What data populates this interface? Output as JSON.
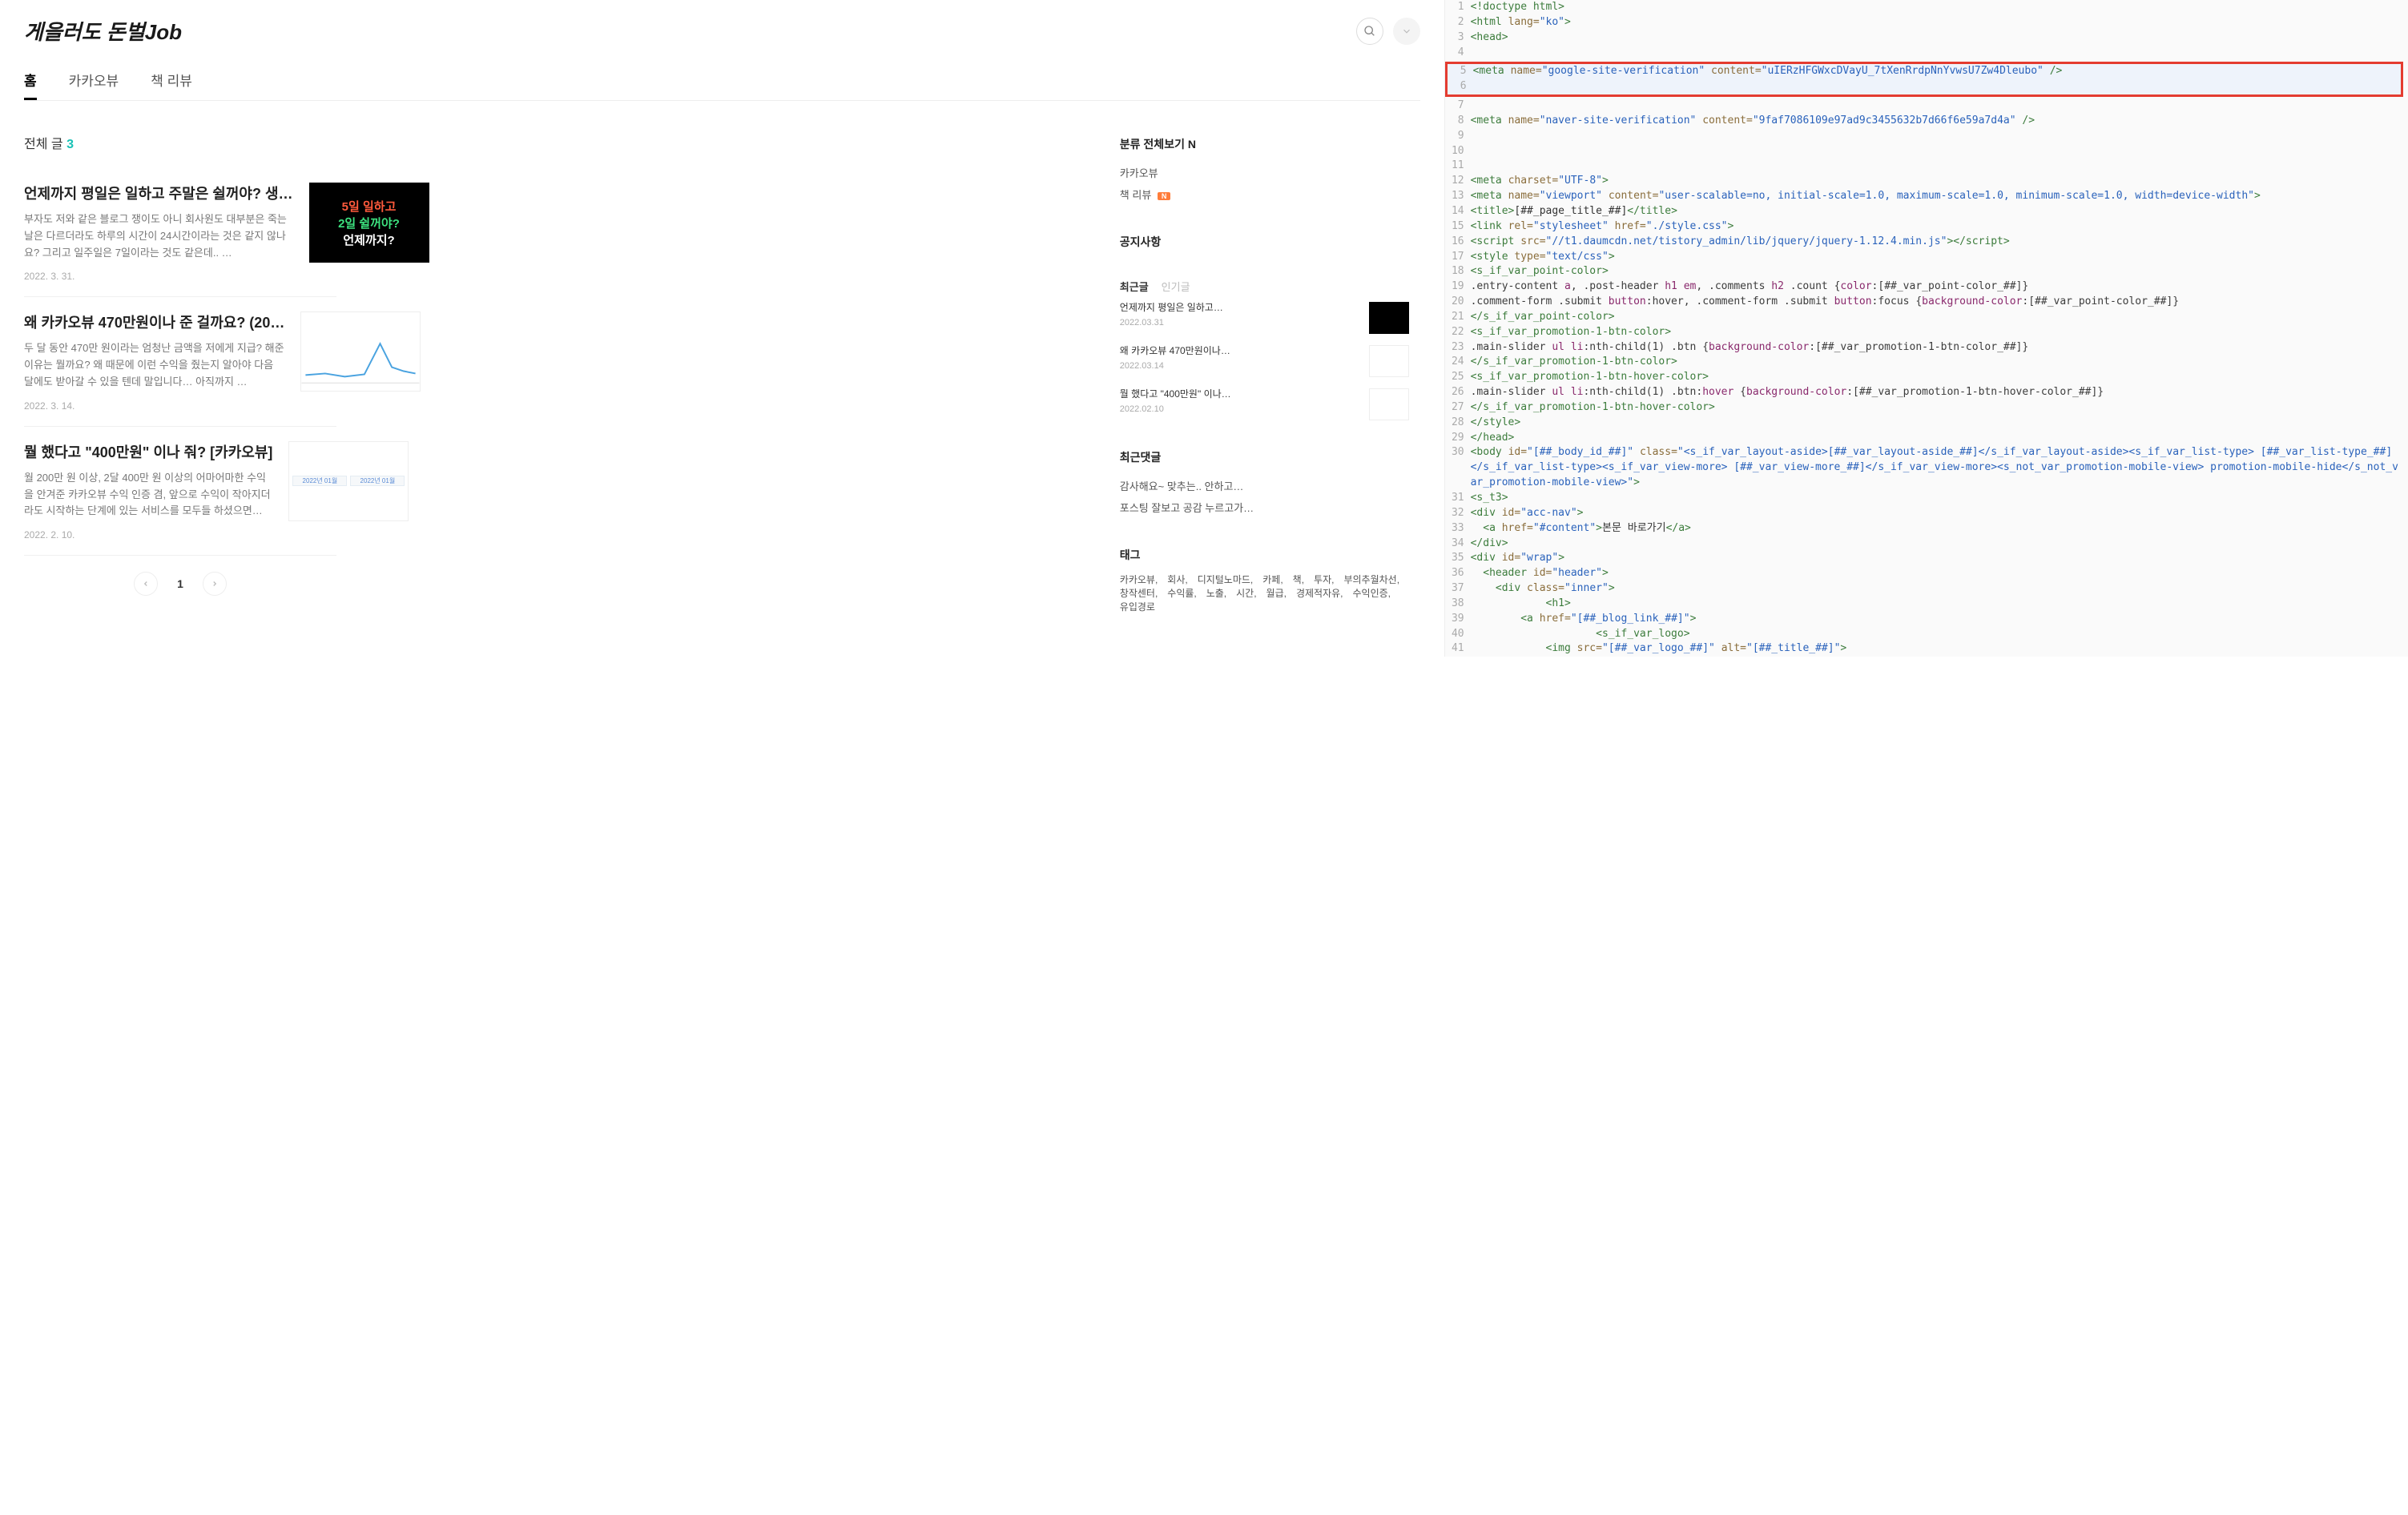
{
  "site": {
    "title": "게을러도 돈벌Job"
  },
  "nav": {
    "home": "홈",
    "kakao": "카카오뷰",
    "review": "책 리뷰"
  },
  "list_header": {
    "label": "전체 글 ",
    "count": "3"
  },
  "posts": [
    {
      "title": "언제까지 평일은 일하고 주말은 쉴꺼야? 생…",
      "excerpt": "부자도 저와 같은 블로그 쟁이도 아니 회사원도 대부분은 죽는 날은 다르더라도 하루의 시간이 24시간이라는 것은 같지 않나요? 그리고 일주일은 7일이라는 것도 같은데.. …",
      "date": "2022. 3. 31.",
      "thumb": {
        "l1": "5일 일하고",
        "l2": "2일 쉴꺼야?",
        "l3": "언제까지?"
      }
    },
    {
      "title": "왜 카카오뷰 470만원이나 준 걸까요? (20…",
      "excerpt": "두 달 동안 470만 원이라는 엄청난 금액을 저에게 지급? 해준 이유는 뭘까요? 왜 때문에 이런 수익을 줬는지 알아야 다음 달에도 받아갈 수 있을 텐데 말입니다… 아직까지 …",
      "date": "2022. 3. 14."
    },
    {
      "title": "뭘 했다고 \"400만원\" 이나 줘? [카카오뷰]",
      "excerpt": "월 200만 원 이상, 2달 400만 원 이상의 어마어마한 수익을 안겨준 카카오뷰 수익 인증 겸, 앞으로 수익이 작아지더라도 시작하는 단계에 있는 서비스를 모두들 하셨으면 좋…",
      "date": "2022. 2. 10."
    }
  ],
  "pagination": {
    "current": "1"
  },
  "sidebar": {
    "cat_title": "분류 전체보기",
    "cat_items": [
      {
        "label": "카카오뷰",
        "badge": ""
      },
      {
        "label": "책 리뷰",
        "badge": "N"
      }
    ],
    "notice_title": "공지사항",
    "recent_tab": "최근글",
    "popular_tab": "인기글",
    "recent": [
      {
        "title": "언제까지 평일은 일하고…",
        "date": "2022.03.31"
      },
      {
        "title": "왜 카카오뷰 470만원이나…",
        "date": "2022.03.14"
      },
      {
        "title": "뭘 했다고 \"400만원\" 이나…",
        "date": "2022.02.10"
      }
    ],
    "comments_title": "최근댓글",
    "comments": [
      "감사해요~ 맞추는.. 안하고…",
      "포스팅 잘보고 공감 누르고가…"
    ],
    "tag_title": "태그",
    "tags": "카카오뷰,　회사,　디지털노마드,　카페,　책,　투자,　부의추월차선,　창작센터,　수익률,　노출,　시간,　월급,　경제적자유,　수익인증,　유입경로"
  },
  "code": {
    "l1": "<!doctype html>",
    "l2_a": "<html ",
    "l2_b": "lang=",
    "l2_c": "\"ko\"",
    "l2_d": ">",
    "l3": "<head>",
    "l5": "<meta name=\"google-site-verification\" content=\"uIERzHFGWxcDVayU_7tXenRrdpNnYvwsU7Zw4Dleubo\" />",
    "l8": "<meta name=\"naver-site-verification\" content=\"9faf7086109e97ad9c3455632b7d66f6e59a7d4a\" />",
    "l12": "<meta charset=\"UTF-8\">",
    "l13": "<meta name=\"viewport\" content=\"user-scalable=no, initial-scale=1.0, maximum-scale=1.0, minimum-scale=1.0, width=device-width\">",
    "l14_a": "<title>",
    "l14_b": "[##_page_title_##]",
    "l14_c": "</title>",
    "l15": "<link rel=\"stylesheet\" href=\"./style.css\">",
    "l16": "<script src=\"//t1.daumcdn.net/tistory_admin/lib/jquery/jquery-1.12.4.min.js\"></script>",
    "l17": "<style type=\"text/css\">",
    "l18": "<s_if_var_point-color>",
    "l19": ".entry-content a, .post-header h1 em, .comments h2 .count {color:[##_var_point-color_##]}",
    "l20": ".comment-form .submit button:hover, .comment-form .submit button:focus {background-color:[##_var_point-color_##]}",
    "l21": "</s_if_var_point-color>",
    "l22": "<s_if_var_promotion-1-btn-color>",
    "l23": ".main-slider ul li:nth-child(1) .btn {background-color:[##_var_promotion-1-btn-color_##]}",
    "l24": "</s_if_var_promotion-1-btn-color>",
    "l25": "<s_if_var_promotion-1-btn-hover-color>",
    "l26": ".main-slider ul li:nth-child(1) .btn:hover {background-color:[##_var_promotion-1-btn-hover-color_##]}",
    "l27": "</s_if_var_promotion-1-btn-hover-color>",
    "l28": "</style>",
    "l29": "</head>",
    "l30": "<body id=\"[##_body_id_##]\" class=\"<s_if_var_layout-aside>[##_var_layout-aside_##]</s_if_var_layout-aside><s_if_var_list-type> [##_var_list-type_##]</s_if_var_list-type><s_if_var_view-more> [##_var_view-more_##]</s_if_var_view-more><s_not_var_promotion-mobile-view> promotion-mobile-hide</s_not_var_promotion-mobile-view>\">",
    "l31": "<s_t3>",
    "l32": "<div id=\"acc-nav\">",
    "l33_a": "  <a href=\"#content\">",
    "l33_b": "본문 바로가기",
    "l33_c": "</a>",
    "l34": "</div>",
    "l35": "<div id=\"wrap\">",
    "l36": "  <header id=\"header\">",
    "l37": "    <div class=\"inner\">",
    "l38": "      <h1>",
    "l39": "        <a href=\"[##_blog_link_##]\">",
    "l40": "          <s_if_var_logo>",
    "l41": "            <img src=\"[##_var_logo_##]\" alt=\"[##_title_##]\">"
  }
}
